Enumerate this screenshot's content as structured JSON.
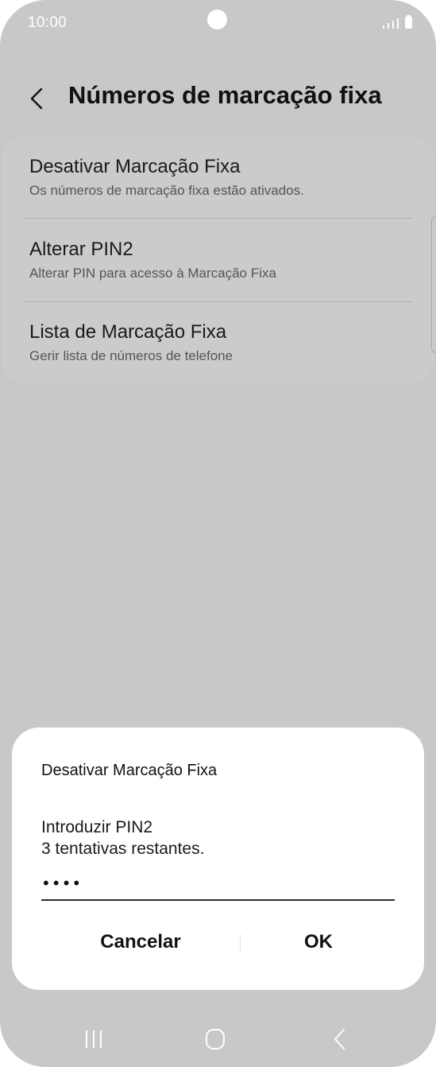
{
  "status_bar": {
    "time": "10:00"
  },
  "header": {
    "title": "Números de marcação fixa",
    "back_icon": "chevron-left-icon"
  },
  "settings": {
    "items": [
      {
        "title": "Desativar Marcação Fixa",
        "subtitle": "Os números de marcação fixa estão ativados."
      },
      {
        "title": "Alterar PIN2",
        "subtitle": "Alterar PIN para acesso à Marcação Fixa"
      },
      {
        "title": "Lista de Marcação Fixa",
        "subtitle": "Gerir lista de números de telefone"
      }
    ]
  },
  "dialog": {
    "title": "Desativar Marcação Fixa",
    "prompt_line1": "Introduzir PIN2",
    "prompt_line2": "3 tentativas restantes.",
    "pin_value": "••••",
    "cancel_label": "Cancelar",
    "ok_label": "OK"
  },
  "nav_bar": {
    "icons": [
      "recent-apps-icon",
      "home-icon",
      "back-icon"
    ]
  },
  "colors": {
    "background_dim": "#c8c8c8",
    "dialog_bg": "#ffffff",
    "text_primary": "#111111"
  }
}
